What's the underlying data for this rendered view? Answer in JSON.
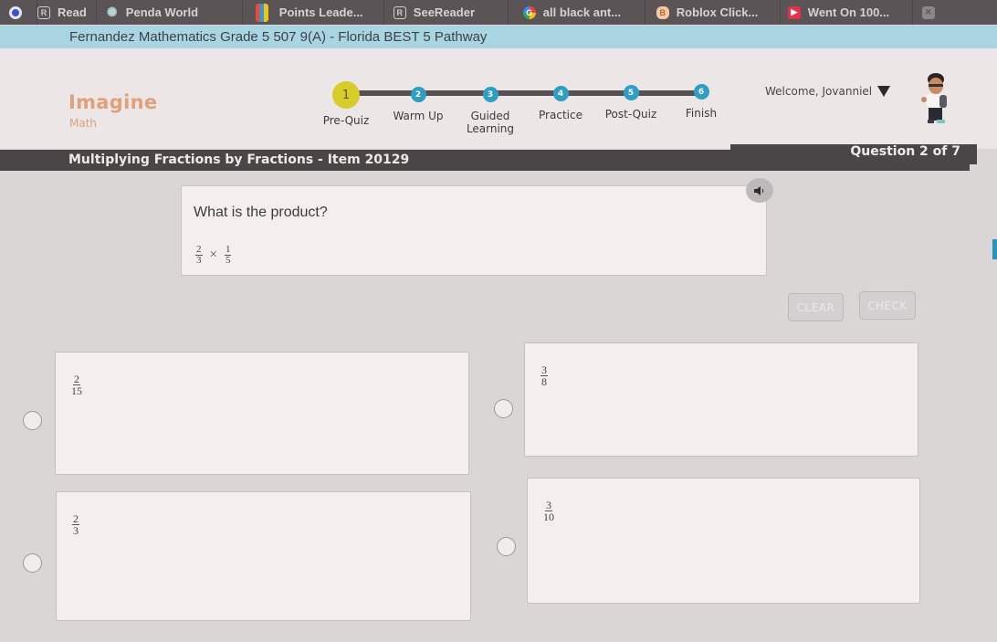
{
  "bookmarks": [
    {
      "label": "",
      "icon": "chrome-profile-icon"
    },
    {
      "label": "Read",
      "icon": "r-icon"
    },
    {
      "label": "Penda World",
      "icon": "penda-icon"
    },
    {
      "label": "Points Leade...",
      "icon": "points-leaderboard-icon"
    },
    {
      "label": "SeeReader",
      "icon": "r-icon"
    },
    {
      "label": "all black ant...",
      "icon": "google-icon"
    },
    {
      "label": "Roblox Click...",
      "icon": "roblox-icon"
    },
    {
      "label": "Went On 100...",
      "icon": "youtube-icon"
    },
    {
      "label": "",
      "icon": "bookmark-icon"
    }
  ],
  "course_title": "Fernandez Mathematics Grade 5 507 9(A) - Florida BEST 5 Pathway",
  "logo": {
    "main": "Imagine",
    "sub": "Math",
    "color": "#e0a07a"
  },
  "progress_steps": [
    {
      "number": "1",
      "label": "Pre-Quiz",
      "active": true
    },
    {
      "number": "2",
      "label": "Warm Up",
      "active": false
    },
    {
      "number": "3",
      "label": "Guided Learning",
      "active": false
    },
    {
      "number": "4",
      "label": "Practice",
      "active": false
    },
    {
      "number": "5",
      "label": "Post-Quiz",
      "active": false
    },
    {
      "number": "6",
      "label": "Finish",
      "active": false
    }
  ],
  "user": {
    "welcome": "Welcome, Jovanniel"
  },
  "item": {
    "title": "Multiplying Fractions by Fractions - Item 20129",
    "question_count": "Question 2 of 7"
  },
  "question": {
    "prompt": "What is the product?",
    "expression": {
      "left": {
        "num": "2",
        "den": "3"
      },
      "operator": "×",
      "right": {
        "num": "1",
        "den": "5"
      }
    }
  },
  "buttons": {
    "clear": "CLEAR",
    "check": "CHECK"
  },
  "options": [
    {
      "num": "2",
      "den": "15",
      "selected": false
    },
    {
      "num": "3",
      "den": "8",
      "selected": false
    },
    {
      "num": "2",
      "den": "3",
      "selected": false
    },
    {
      "num": "3",
      "den": "10",
      "selected": false
    }
  ],
  "colors": {
    "step_active": "#d8cc2a",
    "step_default": "#2f9ec4",
    "title_bar": "#4a4547",
    "course_bar": "#a9d4e2"
  }
}
